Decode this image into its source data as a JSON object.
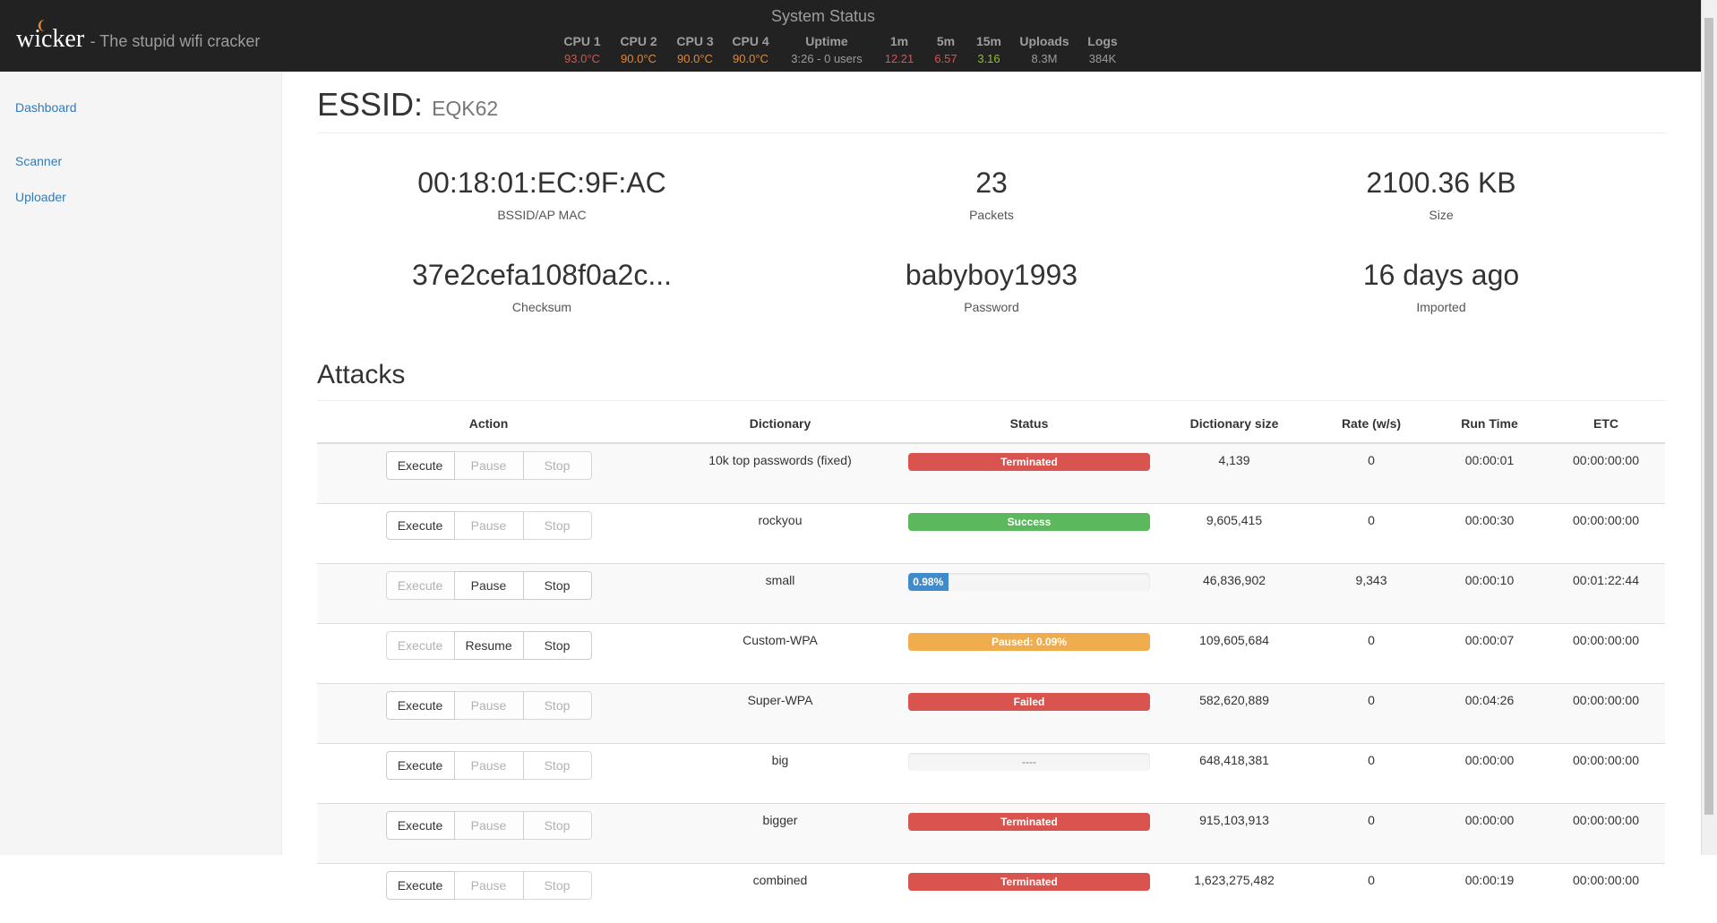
{
  "brand": {
    "name": "wicker",
    "tagline": "- The stupid wifi cracker"
  },
  "system_status": {
    "title": "System Status",
    "stats": [
      {
        "label": "CPU 1",
        "value": "93.0°C",
        "color": "#d9534f"
      },
      {
        "label": "CPU 2",
        "value": "90.0°C",
        "color": "#e8872b"
      },
      {
        "label": "CPU 3",
        "value": "90.0°C",
        "color": "#e8872b"
      },
      {
        "label": "CPU 4",
        "value": "90.0°C",
        "color": "#e8872b"
      },
      {
        "label": "Uptime",
        "value": "3:26 - 0 users",
        "color": "#9d9d9d"
      },
      {
        "label": "1m",
        "value": "12.21",
        "color": "#d9534f"
      },
      {
        "label": "5m",
        "value": "6.57",
        "color": "#d9534f"
      },
      {
        "label": "15m",
        "value": "3.16",
        "color": "#8ebd3a"
      },
      {
        "label": "Uploads",
        "value": "8.3M",
        "color": "#9d9d9d"
      },
      {
        "label": "Logs",
        "value": "384K",
        "color": "#9d9d9d"
      }
    ]
  },
  "sidebar": {
    "items": [
      "Dashboard",
      "Scanner",
      "Uploader"
    ]
  },
  "essid": {
    "label": "ESSID:",
    "value": "EQK62"
  },
  "info": [
    {
      "value": "00:18:01:EC:9F:AC",
      "label": "BSSID/AP MAC"
    },
    {
      "value": "23",
      "label": "Packets"
    },
    {
      "value": "2100.36 KB",
      "label": "Size"
    },
    {
      "value": "37e2cefa108f0a2c...",
      "label": "Checksum"
    },
    {
      "value": "babyboy1993",
      "label": "Password"
    },
    {
      "value": "16 days ago",
      "label": "Imported"
    }
  ],
  "attacks": {
    "heading": "Attacks",
    "columns": [
      "Action",
      "Dictionary",
      "Status",
      "Dictionary size",
      "Rate (w/s)",
      "Run Time",
      "ETC"
    ],
    "rows": [
      {
        "buttons": [
          "Execute",
          "Pause",
          "Stop"
        ],
        "enabled": [
          true,
          false,
          false
        ],
        "dictionary": "10k top passwords (fixed)",
        "status": "Terminated",
        "status_type": "danger",
        "progress": 1,
        "size": "4,139",
        "rate": "0",
        "runtime": "00:00:01",
        "etc": "00:00:00:00"
      },
      {
        "buttons": [
          "Execute",
          "Pause",
          "Stop"
        ],
        "enabled": [
          true,
          false,
          false
        ],
        "dictionary": "rockyou",
        "status": "Success",
        "status_type": "success",
        "progress": 1,
        "size": "9,605,415",
        "rate": "0",
        "runtime": "00:00:30",
        "etc": "00:00:00:00"
      },
      {
        "buttons": [
          "Execute",
          "Pause",
          "Stop"
        ],
        "enabled": [
          false,
          true,
          true
        ],
        "dictionary": "small",
        "status": "0.98%",
        "status_type": "info",
        "progress": 0.165,
        "size": "46,836,902",
        "rate": "9,343",
        "runtime": "00:00:10",
        "etc": "00:01:22:44"
      },
      {
        "buttons": [
          "Execute",
          "Resume",
          "Stop"
        ],
        "enabled": [
          false,
          true,
          true
        ],
        "dictionary": "Custom-WPA",
        "status": "Paused: 0.09%",
        "status_type": "warning",
        "progress": 1,
        "size": "109,605,684",
        "rate": "0",
        "runtime": "00:00:07",
        "etc": "00:00:00:00"
      },
      {
        "buttons": [
          "Execute",
          "Pause",
          "Stop"
        ],
        "enabled": [
          true,
          false,
          false
        ],
        "dictionary": "Super-WPA",
        "status": "Failed",
        "status_type": "danger",
        "progress": 1,
        "size": "582,620,889",
        "rate": "0",
        "runtime": "00:04:26",
        "etc": "00:00:00:00"
      },
      {
        "buttons": [
          "Execute",
          "Pause",
          "Stop"
        ],
        "enabled": [
          true,
          false,
          false
        ],
        "dictionary": "big",
        "status": "----",
        "status_type": "empty",
        "progress": 0,
        "size": "648,418,381",
        "rate": "0",
        "runtime": "00:00:00",
        "etc": "00:00:00:00"
      },
      {
        "buttons": [
          "Execute",
          "Pause",
          "Stop"
        ],
        "enabled": [
          true,
          false,
          false
        ],
        "dictionary": "bigger",
        "status": "Terminated",
        "status_type": "danger",
        "progress": 1,
        "size": "915,103,913",
        "rate": "0",
        "runtime": "00:00:00",
        "etc": "00:00:00:00"
      },
      {
        "buttons": [
          "Execute",
          "Pause",
          "Stop"
        ],
        "enabled": [
          true,
          false,
          false
        ],
        "dictionary": "combined",
        "status": "Terminated",
        "status_type": "danger",
        "progress": 1,
        "size": "1,623,275,482",
        "rate": "0",
        "runtime": "00:00:19",
        "etc": "00:00:00:00"
      }
    ]
  },
  "colors": {
    "danger": "#d9534f",
    "success": "#5cb85c",
    "info": "#428bca",
    "warning": "#f0ad4e",
    "link": "#337ab7"
  }
}
